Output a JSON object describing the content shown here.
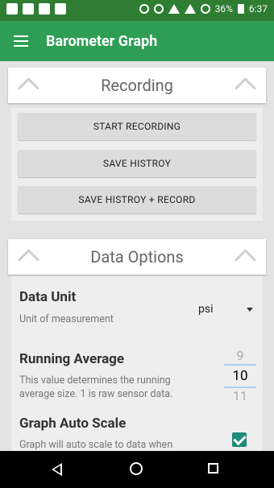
{
  "status_bar": {
    "battery": "36%",
    "time": "6:37"
  },
  "app_bar": {
    "title": "Barometer Graph"
  },
  "recording": {
    "title": "Recording",
    "buttons": [
      "START RECORDING",
      "SAVE HISTROY",
      "SAVE HISTROY + RECORD"
    ]
  },
  "data_options": {
    "title": "Data Options",
    "data_unit": {
      "title": "Data Unit",
      "subtitle": "Unit of measurement",
      "value": "psi"
    },
    "running_average": {
      "title": "Running Average",
      "subtitle": "This value determines the running average size. 1 is raw sensor data.",
      "values": [
        "9",
        "10",
        "11"
      ]
    },
    "auto_scale": {
      "title": "Graph Auto Scale",
      "subtitle": "Graph will auto scale to data when",
      "checked": true
    }
  }
}
